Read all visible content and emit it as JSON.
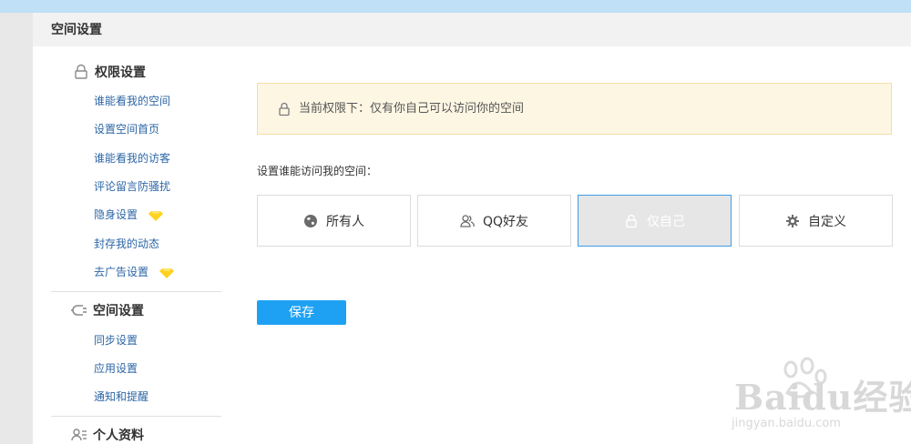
{
  "header": {
    "title": "空间设置"
  },
  "sidebar": {
    "sections": [
      {
        "title": "权限设置",
        "icon": "lock-icon",
        "items": [
          {
            "label": "谁能看我的空间"
          },
          {
            "label": "设置空间首页"
          },
          {
            "label": "谁能看我的访客"
          },
          {
            "label": "评论留言防骚扰"
          },
          {
            "label": "隐身设置",
            "badge": "vip-diamond-icon"
          },
          {
            "label": "封存我的动态"
          },
          {
            "label": "去广告设置",
            "badge": "vip-diamond-icon"
          }
        ]
      },
      {
        "title": "空间设置",
        "icon": "plug-icon",
        "items": [
          {
            "label": "同步设置"
          },
          {
            "label": "应用设置"
          },
          {
            "label": "通知和提醒"
          }
        ]
      },
      {
        "title": "个人资料",
        "icon": "profile-card-icon",
        "items": []
      }
    ]
  },
  "main": {
    "notice": {
      "icon": "lock-icon",
      "text": "当前权限下：仅有你自己可以访问你的空间"
    },
    "prompt": "设置谁能访问我的空间：",
    "options": [
      {
        "label": "所有人",
        "icon": "globe-icon",
        "selected": false
      },
      {
        "label": "QQ好友",
        "icon": "friends-icon",
        "selected": false
      },
      {
        "label": "仅自己",
        "icon": "lock-icon",
        "selected": true
      },
      {
        "label": "自定义",
        "icon": "gear-icon",
        "selected": false
      }
    ],
    "save_label": "保存"
  },
  "watermark": {
    "brand": "Baidu经验",
    "url": "jingyan.baidu.com"
  },
  "colors": {
    "link": "#2d66a6",
    "accent": "#1ea1f3",
    "selected_border": "#3e9de8",
    "notice_bg": "#fdf6e3",
    "notice_border": "#f5dea6",
    "diamond": "#ffd21f"
  }
}
